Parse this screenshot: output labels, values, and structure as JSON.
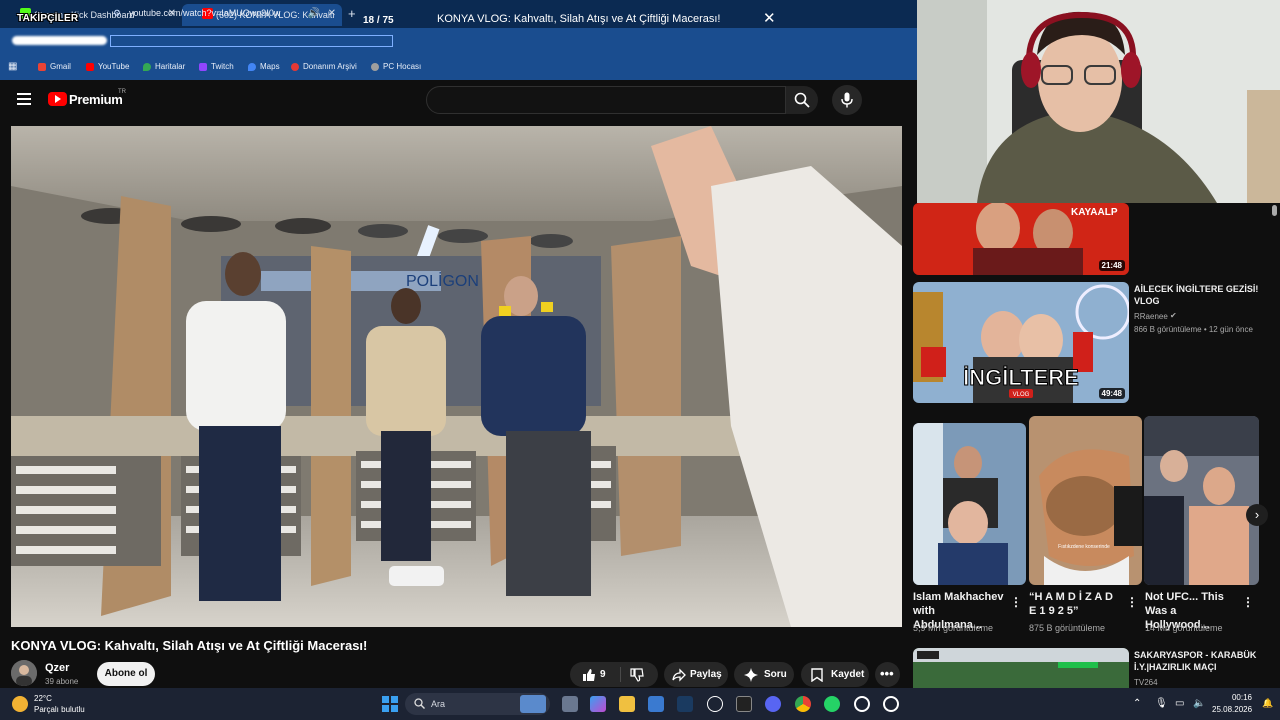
{
  "browser": {
    "tabs": [
      {
        "title": "Stream - Kick Dashboard",
        "favicon_color": "#53fc18"
      },
      {
        "title": "(602) KONYA VLOG: Kahvaltı",
        "favicon_color": "#ff0000"
      }
    ],
    "url": "youtube.com/watch?v=IaMUQwq9I0w",
    "bookmarks": [
      {
        "label": "Gmail",
        "color": "#ea4335"
      },
      {
        "label": "YouTube",
        "color": "#ff0000"
      },
      {
        "label": "Haritalar",
        "color": "#34a853"
      },
      {
        "label": "Twitch",
        "color": "#9146ff"
      },
      {
        "label": "Maps",
        "color": "#4285f4"
      },
      {
        "label": "Donanım Arşivi",
        "color": "#e53935"
      },
      {
        "label": "PC Hocası",
        "color": "#9e9e9e"
      }
    ]
  },
  "stream_overlay": {
    "followers_label": "TAKİPÇİLER",
    "counter": "18 / 75"
  },
  "youtube": {
    "logo_text": "Premium",
    "region": "TR",
    "search_query": "KONYA VLOG: Kahvaltı, Silah Atışı ve At Çiftliği Macerası!"
  },
  "video": {
    "title": "KONYA VLOG: Kahvaltı, Silah Atışı ve At Çiftliği Macerası!",
    "channel": "Qzer",
    "subscribers": "39 abone",
    "subscribe_label": "Abone ol",
    "likes": "9",
    "share_label": "Paylaş",
    "ask_label": "Soru",
    "save_label": "Kaydet"
  },
  "sidebar": {
    "videos": [
      {
        "duration": "21:48",
        "title": "",
        "channel": "",
        "meta": ""
      },
      {
        "duration": "49:48",
        "title": "AİLECEK İNGİLTERE GEZİSİ! VLOG",
        "channel": "RRaenee",
        "meta": "866 B görüntüleme • 12 gün önce",
        "thumb_text": "İNGİLTERE",
        "thumb_badge": "VLOG"
      },
      {
        "duration": "",
        "title": "SAKARYASPOR - KARABÜK İ.Y.|HAZIRLIK MAÇI",
        "channel": "TV264",
        "meta": ""
      }
    ],
    "shorts": [
      {
        "title": "Islam Makhachev with Abdulmana...",
        "views": "5,9 Mn görüntüleme"
      },
      {
        "title": "“H A M D İ Z A D E 1 9 2 5”",
        "views": "875 B görüntüleme"
      },
      {
        "title": "Not UFC... This Was a Hollywood...",
        "views": "14 Mn görüntüleme"
      }
    ]
  },
  "taskbar": {
    "temperature": "22°C",
    "weather": "Parçalı bulutlu",
    "search_placeholder": "Ara",
    "time": "00:16",
    "date": "25.08.2026"
  }
}
